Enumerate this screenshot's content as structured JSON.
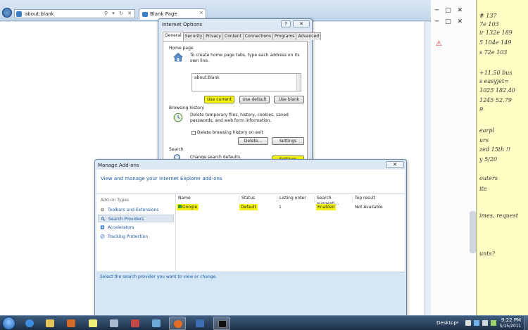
{
  "ie": {
    "address": "about:blank",
    "tab_title": "Blank Page",
    "tab_close": "×",
    "addr_tools": "⚲ ▾ ↻ ✕"
  },
  "mid_window": {
    "controls": "─ ▢ ✕",
    "controls2": "─ ▢ ✕",
    "warning_icon": "warning-triangle-icon"
  },
  "sticky_note": {
    "lines": [
      "# 137",
      "7e 103",
      "ir 132e 189",
      "5 104e 149",
      "s 72e 103",
      "+11.50 bus",
      "s  easyjet=",
      "1025  182.40",
      "1245  52.79",
      "9",
      "earpl",
      "urs",
      "zed 15th !!",
      "y 5/20",
      "outers",
      "ite",
      "imes, request",
      "unts?"
    ]
  },
  "internet_options": {
    "title": "Internet Options",
    "help": "?",
    "close": "✕",
    "tabs": [
      "General",
      "Security",
      "Privacy",
      "Content",
      "Connections",
      "Programs",
      "Advanced"
    ],
    "active_tab": "General",
    "home_page": {
      "title": "Home page",
      "desc": "To create home page tabs, type each address on its own line.",
      "value": "about:blank",
      "btn_current": "Use current",
      "btn_default": "Use default",
      "btn_blank": "Use blank"
    },
    "browsing_history": {
      "title": "Browsing history",
      "desc": "Delete temporary files, history, cookies, saved passwords, and web form information.",
      "checkbox_label": "Delete browsing history on exit",
      "checkbox_checked": false,
      "btn_delete": "Delete...",
      "btn_settings": "Settings"
    },
    "search": {
      "title": "Search",
      "desc": "Change search defaults.",
      "btn_settings": "Settings"
    }
  },
  "manage_addons": {
    "title": "Manage Add-ons",
    "close": "✕",
    "header": "View and manage your Internet Explorer add-ons",
    "types_label": "Add-on Types",
    "types": [
      {
        "label": "Toolbars and Extensions",
        "icon": "gear-icon",
        "selected": false
      },
      {
        "label": "Search Providers",
        "icon": "search-icon",
        "selected": true
      },
      {
        "label": "Accelerators",
        "icon": "accelerator-icon",
        "selected": false
      },
      {
        "label": "Tracking Protection",
        "icon": "tracking-protection-icon",
        "selected": false
      }
    ],
    "columns": [
      "Name",
      "Status",
      "Listing order",
      "Search suggesti...",
      "Top result"
    ],
    "rows": [
      {
        "name": "Google",
        "status": "Default",
        "listing_order": "1",
        "suggestions": "Enabled",
        "top_result": "Not Available"
      }
    ],
    "footer": "Select the search provider you want to view or change."
  },
  "taskbar": {
    "desktop_label": "Desktop",
    "arrow": "«",
    "time": "9:22 PM",
    "date": "5/15/2011"
  },
  "colors": {
    "highlight": "#f5f510",
    "link_blue": "#1c5aa6",
    "dialog_frame": "#dce8f4"
  }
}
